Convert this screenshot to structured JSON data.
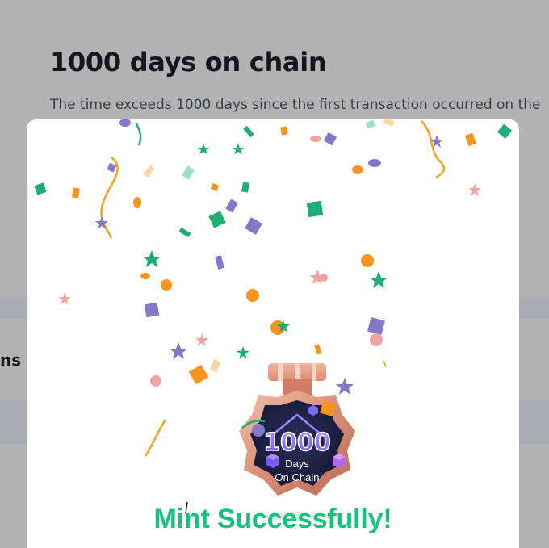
{
  "background": {
    "title": "1000 days on chain",
    "description": "The time exceeds 1000 days since the first transaction occurred on the",
    "side_text": "ns m"
  },
  "modal": {
    "badge": {
      "number": "1000",
      "line1": "Days",
      "line2": "On Chain",
      "icon": "medal-icon"
    },
    "success_message": "Mint Successfully!"
  },
  "colors": {
    "accent_green": "#17c27d",
    "badge_copper": "#e8a289",
    "badge_dark": "#1e2245",
    "badge_purple": "#8c6cf0",
    "confetti_orange": "#f7941d",
    "confetti_purple": "#8479c7",
    "confetti_green": "#1fae73",
    "confetti_pink": "#f4a3a3"
  }
}
